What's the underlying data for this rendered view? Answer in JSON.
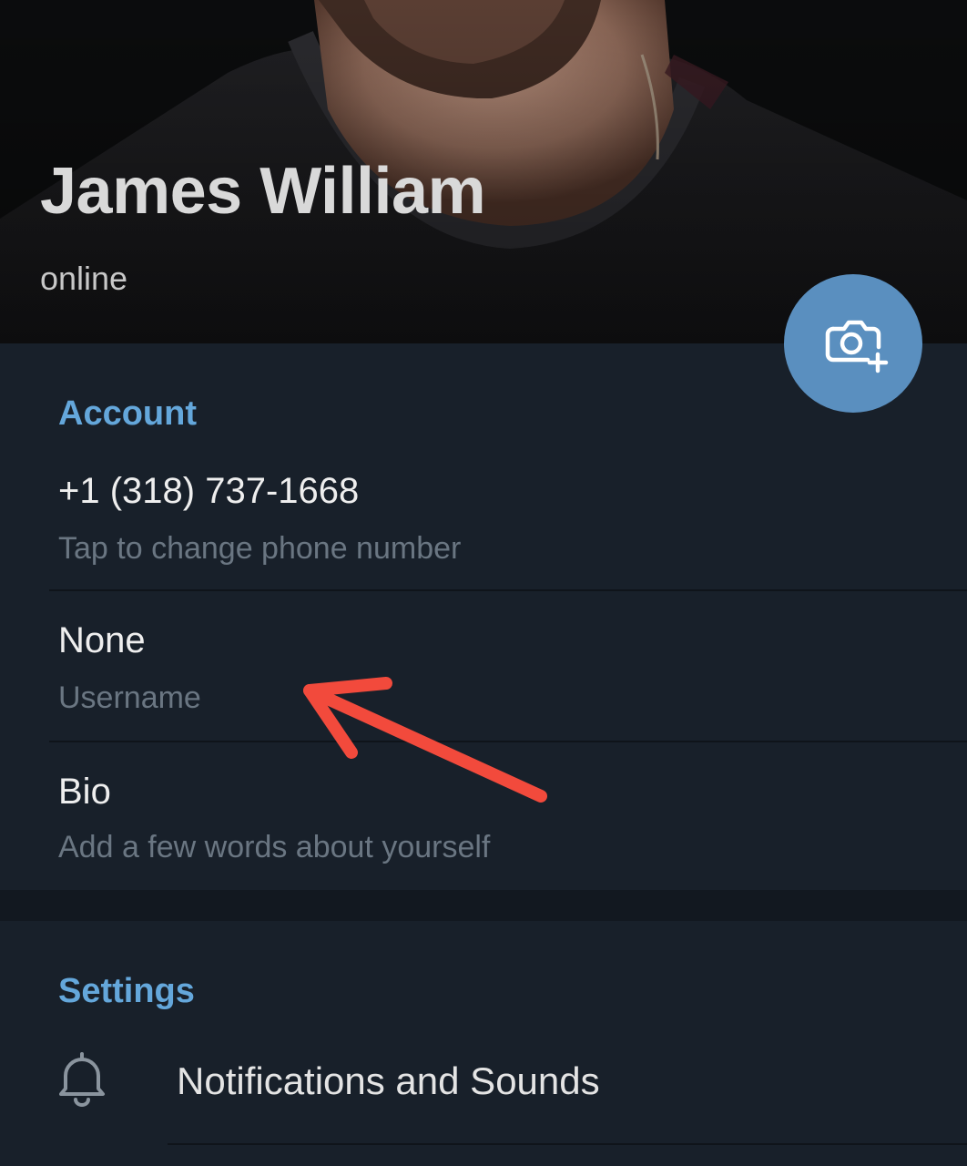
{
  "profile": {
    "name": "James William",
    "status": "online"
  },
  "camera_button": {
    "icon": "camera-add-icon",
    "color": "#5a8fbf"
  },
  "account": {
    "title": "Account",
    "phone": {
      "value": "+1 (318) 737-1668",
      "hint": "Tap to change phone number"
    },
    "username": {
      "value": "None",
      "hint": "Username"
    },
    "bio": {
      "value": "Bio",
      "hint": "Add a few words about yourself"
    }
  },
  "settings": {
    "title": "Settings",
    "items": [
      {
        "label": "Notifications and Sounds",
        "icon": "bell-icon"
      }
    ]
  },
  "colors": {
    "accent": "#64a7db",
    "background": "#18202a",
    "annotation": "#f24a3c"
  }
}
